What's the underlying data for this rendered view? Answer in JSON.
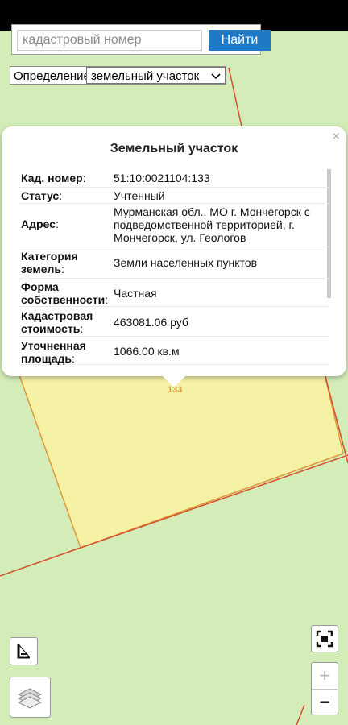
{
  "search": {
    "placeholder": "кадастровый номер",
    "button_label": "Найти"
  },
  "definition": {
    "label": "Определение:",
    "selected": "земельный участок"
  },
  "map": {
    "parcel_label": "133",
    "colors": {
      "background": "#d4edb8",
      "parcel_fill": "#f5f2a6",
      "boundary": "#d4502c"
    },
    "controls": {
      "ruler_icon": "ruler-icon",
      "layers_icon": "layers-icon",
      "locate_icon": "locate-icon",
      "zoom_in": "+",
      "zoom_out": "−"
    }
  },
  "popup": {
    "title": "Земельный участок",
    "close": "×",
    "rows": [
      {
        "label": "Кад. номер",
        "colon": ":",
        "value": "51:10:0021104:133"
      },
      {
        "label": "Статус",
        "colon": ":",
        "value": "Учтенный"
      },
      {
        "label": "Адрес",
        "colon": ":",
        "value": "Мурманская обл., МО г. Мончегорск с подведомственной территорией, г. Мончегорск, ул. Геологов"
      },
      {
        "label": "Категория земель",
        "colon": ":",
        "value": "Земли населенных пунктов"
      },
      {
        "label": "Форма собственности",
        "colon": ":",
        "value": "Частная"
      },
      {
        "label": "Кадастровая стоимость",
        "colon": ":",
        "value": "463081.06 руб"
      },
      {
        "label": "Уточненная площадь",
        "colon": ":",
        "value": "1066.00 кв.м"
      }
    ]
  }
}
